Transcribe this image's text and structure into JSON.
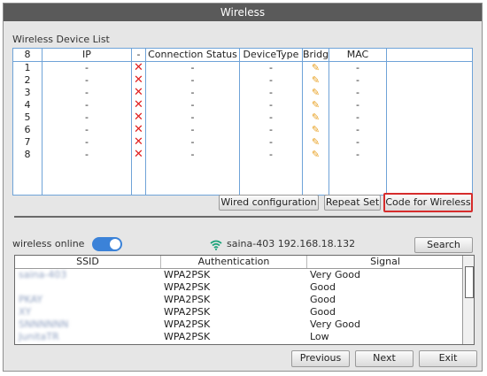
{
  "window": {
    "title": "Wireless"
  },
  "device_list": {
    "section_label": "Wireless Device List",
    "headers": {
      "index": "8",
      "ip": "IP",
      "status_icon": "-",
      "connection_status": "Connection Status",
      "device_type": "DeviceType",
      "bridge": "Bridge",
      "mac": "MAC"
    },
    "rows": [
      {
        "index": "1",
        "ip": "-",
        "status": "-",
        "type": "-",
        "mac": "-"
      },
      {
        "index": "2",
        "ip": "-",
        "status": "-",
        "type": "-",
        "mac": "-"
      },
      {
        "index": "3",
        "ip": "-",
        "status": "-",
        "type": "-",
        "mac": "-"
      },
      {
        "index": "4",
        "ip": "-",
        "status": "-",
        "type": "-",
        "mac": "-"
      },
      {
        "index": "5",
        "ip": "-",
        "status": "-",
        "type": "-",
        "mac": "-"
      },
      {
        "index": "6",
        "ip": "-",
        "status": "-",
        "type": "-",
        "mac": "-"
      },
      {
        "index": "7",
        "ip": "-",
        "status": "-",
        "type": "-",
        "mac": "-"
      },
      {
        "index": "8",
        "ip": "-",
        "status": "-",
        "type": "-",
        "mac": "-"
      }
    ],
    "disconnected_icon": "x-icon",
    "bridge_icon": "pencil-icon"
  },
  "actions": {
    "wired_configuration": "Wired configuration",
    "repeat_set": "Repeat Set",
    "code_for_wireless": "Code for Wireless"
  },
  "wireless_online": {
    "label": "wireless online",
    "enabled": true,
    "network_info": "saina-403 192.168.18.132",
    "wifi_icon": "wifi-icon",
    "search_label": "Search"
  },
  "networks": {
    "headers": {
      "ssid": "SSID",
      "auth": "Authentication",
      "signal": "Signal"
    },
    "rows": [
      {
        "ssid": "saina-403",
        "auth": "WPA2PSK",
        "signal": "Very Good"
      },
      {
        "ssid": "",
        "auth": "WPA2PSK",
        "signal": "Good"
      },
      {
        "ssid": "PKAY",
        "auth": "WPA2PSK",
        "signal": "Good"
      },
      {
        "ssid": "XY",
        "auth": "WPA2PSK",
        "signal": "Good"
      },
      {
        "ssid": "SNNNNNN",
        "auth": "WPA2PSK",
        "signal": "Very Good"
      },
      {
        "ssid": "JunitaTR",
        "auth": "WPA2PSK",
        "signal": "Low"
      }
    ]
  },
  "footer": {
    "previous": "Previous",
    "next": "Next",
    "exit": "Exit"
  },
  "colors": {
    "accent": "#3b82d8",
    "highlight_border": "#d62c2c",
    "disconnected": "#e02020",
    "bridge_icon": "#e8a020"
  }
}
